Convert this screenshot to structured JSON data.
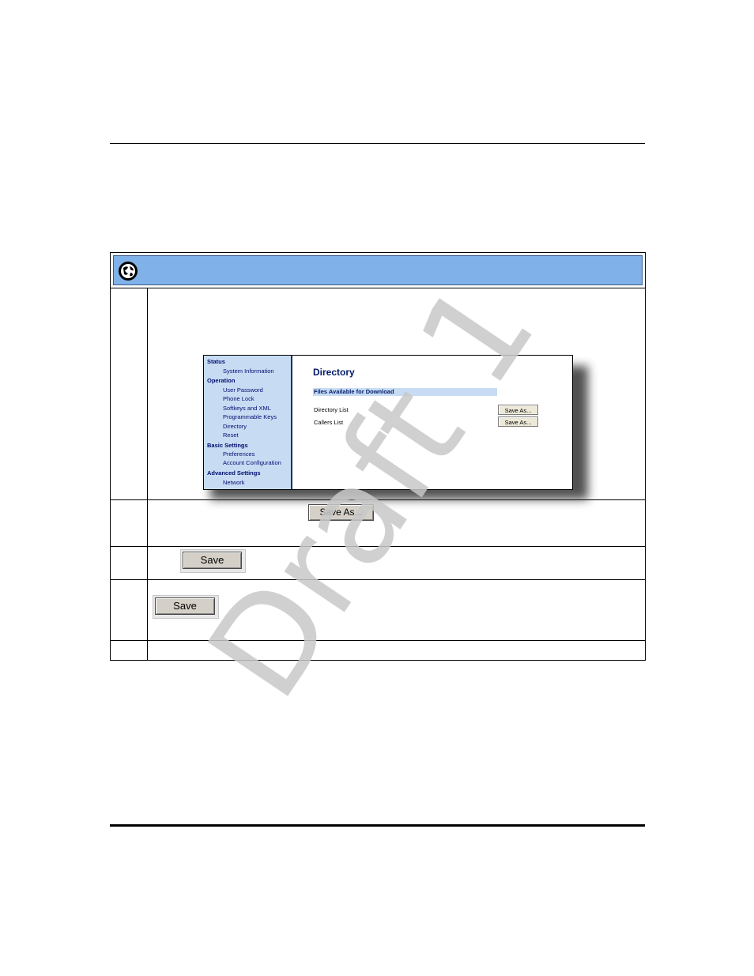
{
  "embedded_ui": {
    "nav": {
      "sections": [
        {
          "heading": "Status",
          "items": [
            "System Information"
          ]
        },
        {
          "heading": "Operation",
          "items": [
            "User Password",
            "Phone Lock",
            "Softkeys and XML",
            "Programmable Keys",
            "Directory",
            "Reset"
          ]
        },
        {
          "heading": "Basic Settings",
          "items": [
            "Preferences",
            "Account Configuration"
          ]
        },
        {
          "heading": "Advanced Settings",
          "items": [
            "Network"
          ]
        }
      ]
    },
    "page_title": "Directory",
    "section_band": "Files Available for Download",
    "rows": [
      {
        "label": "Directory List",
        "button": "Save As..."
      },
      {
        "label": "Callers List",
        "button": "Save As..."
      }
    ]
  },
  "steps": {
    "save_as_button": "Save As...",
    "save_button_1": "Save",
    "save_button_2": "Save"
  },
  "watermark": "Draft 1",
  "colors": {
    "header_band": "#80b1e8",
    "nav_bg": "#c7dcf3",
    "nav_text": "#000d70"
  }
}
